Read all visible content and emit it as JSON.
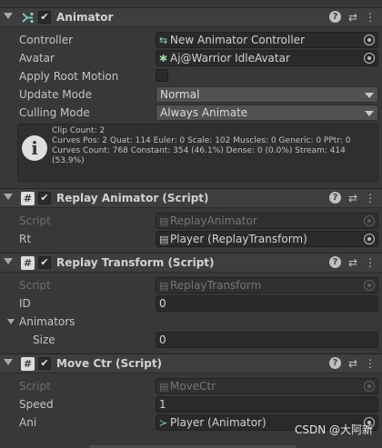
{
  "components": {
    "animator": {
      "title": "Animator",
      "enabled_mark": "✔",
      "fields": {
        "controller": {
          "label": "Controller",
          "value": "New Animator Controller"
        },
        "avatar": {
          "label": "Avatar",
          "value": "Aj@Warrior IdleAvatar"
        },
        "apply_root_motion": {
          "label": "Apply Root Motion",
          "checked": false
        },
        "update_mode": {
          "label": "Update Mode",
          "value": "Normal"
        },
        "culling_mode": {
          "label": "Culling Mode",
          "value": "Always Animate"
        }
      },
      "info": {
        "line1": "Clip Count: 2",
        "line2": "Curves Pos: 2 Quat: 114 Euler: 0 Scale: 102 Muscles: 0 Generic: 0 PPtr: 0",
        "line3": "Curves Count: 768 Constant: 354 (46.1%) Dense: 0 (0.0%) Stream: 414 (53.9%)"
      }
    },
    "replay_animator": {
      "title": "Replay Animator (Script)",
      "enabled_mark": "✔",
      "script": {
        "label": "Script",
        "value": "ReplayAnimator"
      },
      "rt": {
        "label": "Rt",
        "value": "Player (ReplayTransform)"
      }
    },
    "replay_transform": {
      "title": "Replay Transform (Script)",
      "enabled_mark": "✔",
      "script": {
        "label": "Script",
        "value": "ReplayTransform"
      },
      "id": {
        "label": "ID",
        "value": "0"
      },
      "animators": {
        "label": "Animators"
      },
      "size": {
        "label": "Size",
        "value": "0"
      }
    },
    "move_ctr": {
      "title": "Move Ctr (Script)",
      "enabled_mark": "✔",
      "script": {
        "label": "Script",
        "value": "MoveCtr"
      },
      "speed": {
        "label": "Speed",
        "value": "1"
      },
      "ani": {
        "label": "Ani",
        "value": "Player (Animator)"
      }
    }
  },
  "header_icons": {
    "help": "?",
    "presets": "⇄",
    "more": "⋮"
  },
  "watermark": "CSDN @大阿新"
}
